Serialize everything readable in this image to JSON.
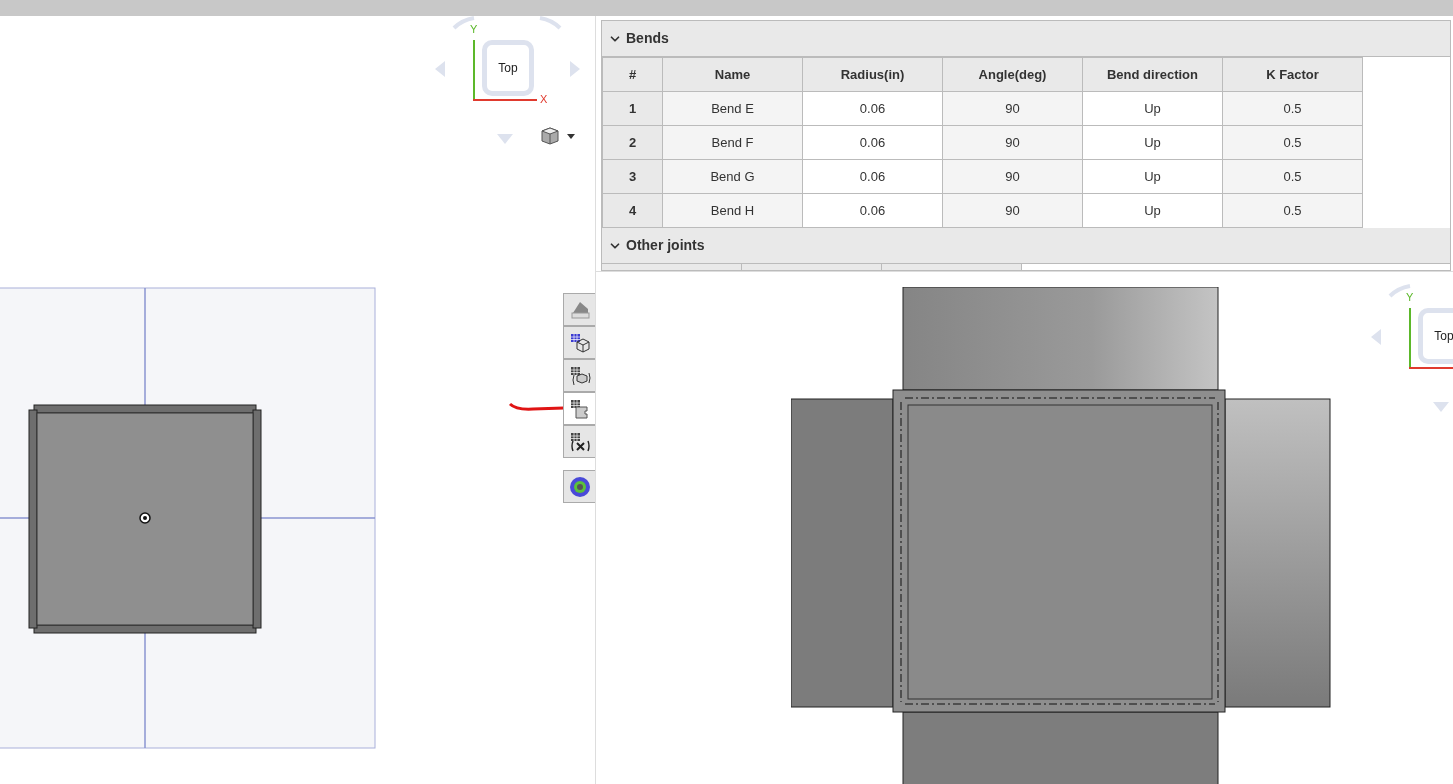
{
  "left_viewport": {
    "view_cube": {
      "face": "Top",
      "y_axis": "Y",
      "x_axis": "X"
    },
    "toolbar": [
      {
        "kind": "appearance",
        "selected": false
      },
      {
        "kind": "table-cube",
        "selected": false
      },
      {
        "kind": "table-cube-brackets",
        "selected": false
      },
      {
        "kind": "flat-table",
        "selected": true
      },
      {
        "kind": "table-function",
        "selected": false
      },
      {
        "kind": "color-ring",
        "selected": false
      }
    ]
  },
  "table_panel": {
    "sections": [
      {
        "title": "Bends",
        "expanded": true,
        "columns": [
          "#",
          "Name",
          "Radius(in)",
          "Angle(deg)",
          "Bend direction",
          "K Factor"
        ],
        "rows": [
          [
            "1",
            "Bend E",
            "0.06",
            "90",
            "Up",
            "0.5"
          ],
          [
            "2",
            "Bend F",
            "0.06",
            "90",
            "Up",
            "0.5"
          ],
          [
            "3",
            "Bend G",
            "0.06",
            "90",
            "Up",
            "0.5"
          ],
          [
            "4",
            "Bend H",
            "0.06",
            "90",
            "Up",
            "0.5"
          ]
        ]
      },
      {
        "title": "Other joints",
        "expanded": true
      }
    ]
  },
  "right_viewport": {
    "view_cube": {
      "face": "Top",
      "y_axis": "Y"
    }
  }
}
